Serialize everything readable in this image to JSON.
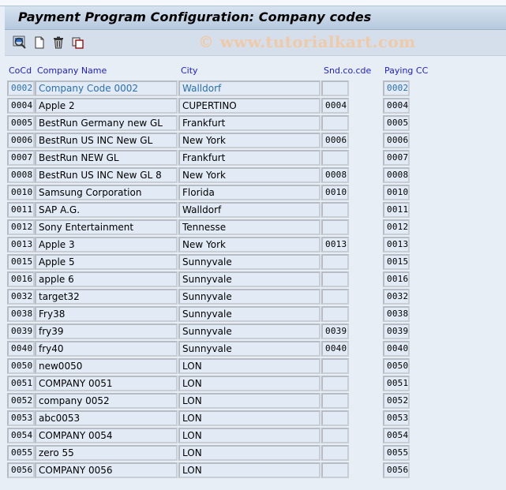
{
  "window": {
    "title": "Payment Program Configuration: Company codes",
    "watermark": "© www.tutorialkart.com"
  },
  "toolbar": {
    "buttons": [
      {
        "name": "details-icon",
        "label": "Details"
      },
      {
        "name": "new-entries-icon",
        "label": "New Entries"
      },
      {
        "name": "delete-icon",
        "label": "Delete"
      },
      {
        "name": "copy-icon",
        "label": "Copy As"
      }
    ]
  },
  "table": {
    "columns": {
      "cocd": "CoCd",
      "name": "Company Name",
      "city": "City",
      "snd": "Snd.co.cde",
      "pay": "Paying CC"
    },
    "rows": [
      {
        "cocd": "0002",
        "name": "Company Code 0002",
        "city": "Walldorf",
        "snd": "",
        "pay": "0002"
      },
      {
        "cocd": "0004",
        "name": "Apple 2",
        "city": "CUPERTINO",
        "snd": "0004",
        "pay": "0004"
      },
      {
        "cocd": "0005",
        "name": "BestRun Germany new GL",
        "city": "Frankfurt",
        "snd": "",
        "pay": "0005"
      },
      {
        "cocd": "0006",
        "name": "BestRun US INC New GL",
        "city": "New York",
        "snd": "0006",
        "pay": "0006"
      },
      {
        "cocd": "0007",
        "name": "BestRun NEW GL",
        "city": "Frankfurt",
        "snd": "",
        "pay": "0007"
      },
      {
        "cocd": "0008",
        "name": "BestRun US INC New GL 8",
        "city": "New York",
        "snd": "0008",
        "pay": "0008"
      },
      {
        "cocd": "0010",
        "name": "Samsung Corporation",
        "city": "Florida",
        "snd": "0010",
        "pay": "0010"
      },
      {
        "cocd": "0011",
        "name": "SAP A.G.",
        "city": "Walldorf",
        "snd": "",
        "pay": "0011"
      },
      {
        "cocd": "0012",
        "name": "Sony Entertainment",
        "city": "Tennesse",
        "snd": "",
        "pay": "0012"
      },
      {
        "cocd": "0013",
        "name": "Apple 3",
        "city": "New York",
        "snd": "0013",
        "pay": "0013"
      },
      {
        "cocd": "0015",
        "name": "Apple 5",
        "city": "Sunnyvale",
        "snd": "",
        "pay": "0015"
      },
      {
        "cocd": "0016",
        "name": "apple 6",
        "city": "Sunnyvale",
        "snd": "",
        "pay": "0016"
      },
      {
        "cocd": "0032",
        "name": "target32",
        "city": "Sunnyvale",
        "snd": "",
        "pay": "0032"
      },
      {
        "cocd": "0038",
        "name": "Fry38",
        "city": "Sunnyvale",
        "snd": "",
        "pay": "0038"
      },
      {
        "cocd": "0039",
        "name": "fry39",
        "city": "Sunnyvale",
        "snd": "0039",
        "pay": "0039"
      },
      {
        "cocd": "0040",
        "name": "fry40",
        "city": "Sunnyvale",
        "snd": "0040",
        "pay": "0040"
      },
      {
        "cocd": "0050",
        "name": "new0050",
        "city": "LON",
        "snd": "",
        "pay": "0050"
      },
      {
        "cocd": "0051",
        "name": "COMPANY 0051",
        "city": "LON",
        "snd": "",
        "pay": "0051"
      },
      {
        "cocd": "0052",
        "name": "company 0052",
        "city": "LON",
        "snd": "",
        "pay": "0052"
      },
      {
        "cocd": "0053",
        "name": "abc0053",
        "city": "LON",
        "snd": "",
        "pay": "0053"
      },
      {
        "cocd": "0054",
        "name": "COMPANY 0054",
        "city": "LON",
        "snd": "",
        "pay": "0054"
      },
      {
        "cocd": "0055",
        "name": "zero 55",
        "city": "LON",
        "snd": "",
        "pay": "0055"
      },
      {
        "cocd": "0056",
        "name": "COMPANY 0056",
        "city": "LON",
        "snd": "",
        "pay": "0056"
      }
    ]
  },
  "colors": {
    "header_text": "#2020d0",
    "first_row_text": "#2a6fb0",
    "background": "#e8eef6"
  }
}
